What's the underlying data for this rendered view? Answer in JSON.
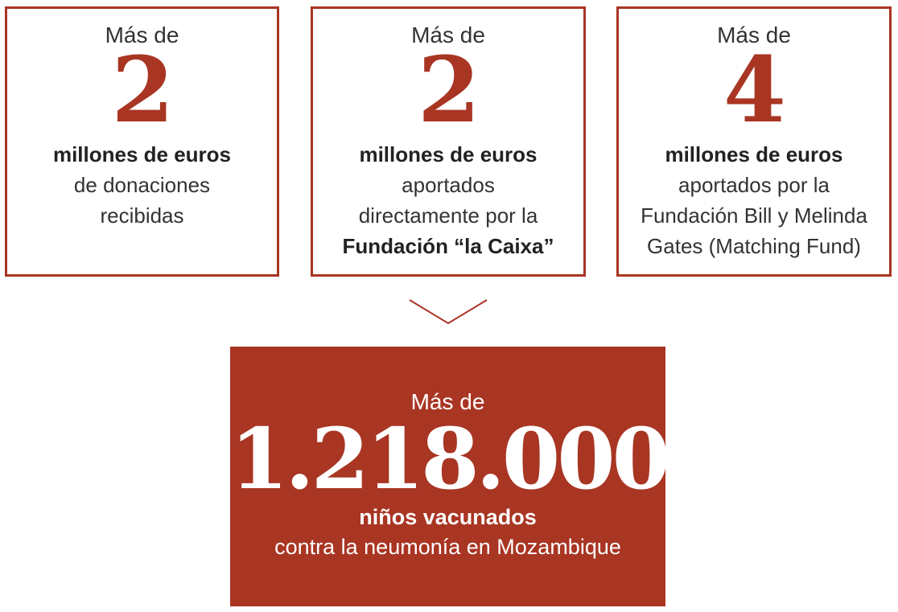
{
  "colors": {
    "accent": "#a93523",
    "text": "#222222",
    "white": "#ffffff"
  },
  "cards": [
    {
      "prefix": "Más de",
      "number": "2",
      "strong": "millones de euros",
      "desc_line1": "de donaciones",
      "desc_line2": "recibidas"
    },
    {
      "prefix": "Más de",
      "number": "2",
      "strong": "millones de euros",
      "desc_line1": "aportados",
      "desc_line2": "directamente por la",
      "desc_line3": "Fundación “la Caixa”"
    },
    {
      "prefix": "Más de",
      "number": "4",
      "strong": "millones de euros",
      "desc_line1": "aportados por la",
      "desc_line2": "Fundación Bill y Melinda",
      "desc_line3": "Gates (Matching Fund)"
    }
  ],
  "connector_icon": "chevron-down-icon",
  "result": {
    "prefix": "Más de",
    "number": "1.218.000",
    "strong": "niños vacunados",
    "desc": "contra la neumonía en Mozambique"
  }
}
